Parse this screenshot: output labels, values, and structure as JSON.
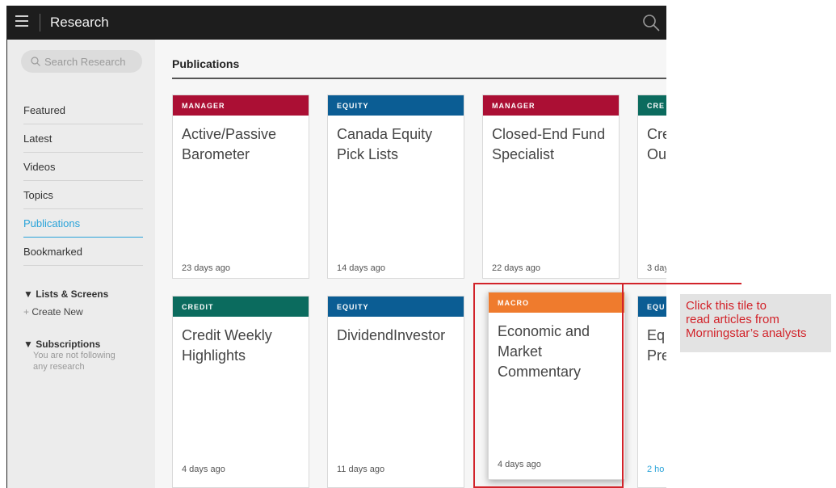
{
  "app": {
    "title": "Research"
  },
  "sidebar": {
    "search_placeholder": "Search Research",
    "nav": [
      {
        "label": "Featured"
      },
      {
        "label": "Latest"
      },
      {
        "label": "Videos"
      },
      {
        "label": "Topics"
      },
      {
        "label": "Publications",
        "active": true
      },
      {
        "label": "Bookmarked"
      }
    ],
    "lists_screens": {
      "heading": "Lists & Screens",
      "create_new": "Create New"
    },
    "subscriptions": {
      "heading": "Subscriptions",
      "empty_line1": "You are not following",
      "empty_line2": "any research"
    }
  },
  "main": {
    "title": "Publications",
    "tiles": [
      {
        "category": "MANAGER",
        "color": "#ab0f34",
        "name_line1": "Active/Passive",
        "name_line2": "Barometer",
        "age": "23 days ago"
      },
      {
        "category": "EQUITY",
        "color": "#0b5d94",
        "name_line1": "Canada Equity",
        "name_line2": "Pick Lists",
        "age": "14 days ago"
      },
      {
        "category": "MANAGER",
        "color": "#ab0f34",
        "name_line1": "Closed-End Fund",
        "name_line2": "Specialist",
        "age": "22 days ago"
      },
      {
        "category": "CRE",
        "color": "#0b6b5e",
        "name_line1": "Cre",
        "name_line2": "Ou",
        "age": "3 day"
      },
      {
        "category": "CREDIT",
        "color": "#0b6b5e",
        "name_line1": "Credit Weekly",
        "name_line2": "Highlights",
        "age": "4 days ago"
      },
      {
        "category": "EQUITY",
        "color": "#0b5d94",
        "name_line1": "DividendInvestor",
        "name_line2": "",
        "age": "11 days ago"
      },
      {
        "category": "MACRO",
        "color": "#ef7b2d",
        "name_line1": "Economic and",
        "name_line2": "Market",
        "name_line3": "Commentary",
        "age": "4 days ago"
      },
      {
        "category": "EQU",
        "color": "#0b5d94",
        "name_line1": "Eq",
        "name_line2": "Pre",
        "age": "2 ho",
        "age_color": "#29a3d9"
      }
    ]
  },
  "callout": {
    "line1": "Click this tile to",
    "line2": "read articles from",
    "line3": "Morningstar’s analysts",
    "color": "#d2232a"
  }
}
